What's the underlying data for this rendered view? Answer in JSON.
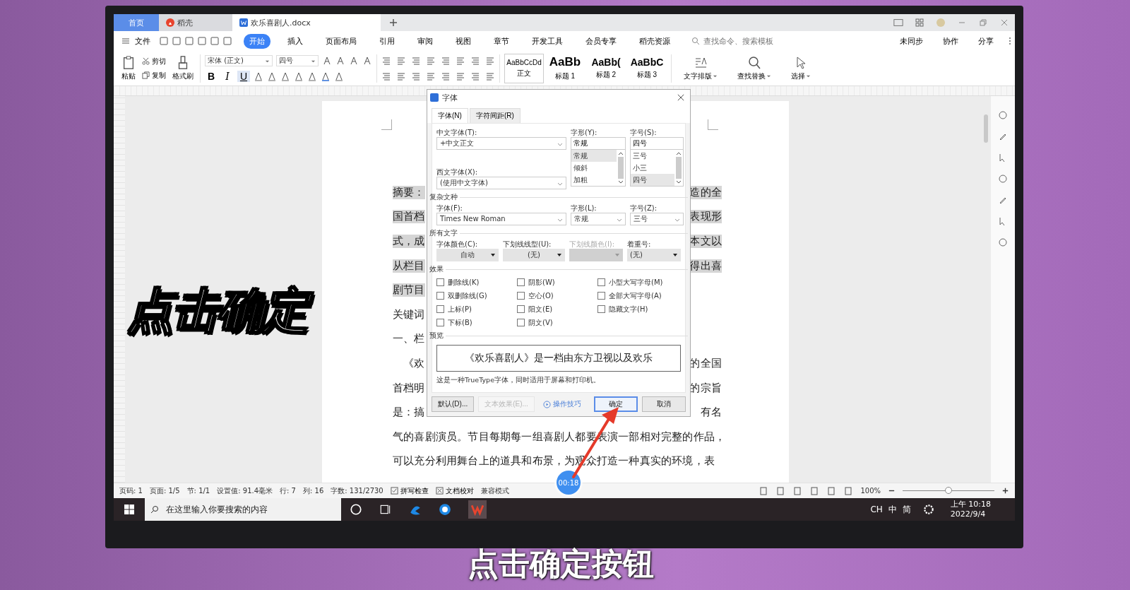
{
  "app_tabs": [
    {
      "label": "首页",
      "kind": "home",
      "selected": false
    },
    {
      "label": "稻壳",
      "kind": "app",
      "selected": false
    },
    {
      "label": "欢乐喜剧人.docx",
      "kind": "doc",
      "selected": true
    }
  ],
  "file_menu": "文件",
  "ribbon_tabs": [
    {
      "label": "开始",
      "selected": true
    },
    {
      "label": "插入",
      "selected": false
    },
    {
      "label": "页面布局",
      "selected": false
    },
    {
      "label": "引用",
      "selected": false
    },
    {
      "label": "审阅",
      "selected": false
    },
    {
      "label": "视图",
      "selected": false
    },
    {
      "label": "章节",
      "selected": false
    },
    {
      "label": "开发工具",
      "selected": false
    },
    {
      "label": "会员专享",
      "selected": false
    },
    {
      "label": "稻壳资源",
      "selected": false
    }
  ],
  "command_search": {
    "placeholder": "查找命令、搜索模板"
  },
  "header_actions": [
    "未同步",
    "协作",
    "分享"
  ],
  "clipboard": {
    "paste": "粘贴",
    "cut": "剪切",
    "copy": "复制",
    "format_painter": "格式刷"
  },
  "font_name": "宋体 (正文)",
  "font_size": "四号",
  "format_buttons": [
    "B",
    "I",
    "U"
  ],
  "styles": [
    {
      "sample": "AaBbCcDd",
      "name": "正文",
      "selected": true
    },
    {
      "sample": "AaBb",
      "name": "标题 1",
      "selected": false
    },
    {
      "sample": "AaBb(",
      "name": "标题 2",
      "selected": false
    },
    {
      "sample": "AaBbC",
      "name": "标题 3",
      "selected": false
    }
  ],
  "tools": [
    "文字排版",
    "查找替换",
    "选择"
  ],
  "document": {
    "lines": [
      {
        "left": "摘要：",
        "right": "造的全",
        "highlighted": true
      },
      {
        "left": "国首档",
        "right": "表现形",
        "highlighted": true
      },
      {
        "left": "式，成",
        "right": "本文以",
        "highlighted": true
      },
      {
        "left": "从栏目",
        "right": "得出喜",
        "highlighted": true
      },
      {
        "left": "剧节目",
        "highlighted": true
      },
      {
        "left": "关键词",
        "highlighted": false
      },
      {
        "left": "一、栏",
        "highlighted": false
      },
      {
        "left": "　《欢",
        "right": "的全国",
        "highlighted": false
      },
      {
        "left": "首档明",
        "right": "的宗旨",
        "highlighted": false
      },
      {
        "left": "是：搞",
        "right": "有名",
        "highlighted": false
      },
      {
        "left": "气的喜剧演员。节目每期每一组喜剧人都要表演一部相对完整的作品，",
        "highlighted": false
      },
      {
        "left": "可以充分利用舞台上的道具和布景，为观众打造一种真实的环境，表",
        "highlighted": false
      }
    ]
  },
  "dialog": {
    "title": "字体",
    "tabs": [
      {
        "label": "字体(N)",
        "selected": true
      },
      {
        "label": "字符间距(R)",
        "selected": false
      }
    ],
    "chinese_font": {
      "label": "中文字体(T):",
      "value": "+中文正文"
    },
    "western_font": {
      "label": "西文字体(X):",
      "value": "(使用中文字体)"
    },
    "style": {
      "label": "字形(Y):",
      "value": "常规",
      "options": [
        {
          "label": "常规",
          "selected": true
        },
        {
          "label": "倾斜",
          "selected": false
        },
        {
          "label": "加粗",
          "selected": false
        }
      ]
    },
    "size": {
      "label": "字号(S):",
      "value": "四号",
      "options": [
        {
          "label": "三号",
          "selected": false
        },
        {
          "label": "小三",
          "selected": false
        },
        {
          "label": "四号",
          "selected": true
        }
      ]
    },
    "complex_section": "复杂文种",
    "complex_fields": [
      {
        "label": "字体(F):",
        "value": "Times New Roman"
      },
      {
        "label": "字形(L):",
        "value": "常规"
      },
      {
        "label": "字号(Z):",
        "value": "三号"
      }
    ],
    "all_text_section": "所有文字",
    "all_text_fields": [
      {
        "label": "字体颜色(C):",
        "value": "自动",
        "disabled": false
      },
      {
        "label": "下划线线型(U):",
        "value": "(无)",
        "disabled": false
      },
      {
        "label": "下划线颜色(I):",
        "disabled": true
      },
      {
        "label": "着重号:",
        "value": "(无)",
        "disabled": false
      }
    ],
    "effects_section": "效果",
    "effects": [
      {
        "label": "删除线(K)",
        "checked": false
      },
      {
        "label": "阴影(W)",
        "checked": false
      },
      {
        "label": "小型大写字母(M)",
        "checked": false
      },
      {
        "label": "双删除线(G)",
        "checked": false
      },
      {
        "label": "空心(O)",
        "checked": false
      },
      {
        "label": "全部大写字母(A)",
        "checked": false
      },
      {
        "label": "上标(P)",
        "checked": false
      },
      {
        "label": "阳文(E)",
        "checked": false
      },
      {
        "label": "隐藏文字(H)",
        "checked": false
      },
      {
        "label": "下标(B)",
        "checked": false
      },
      {
        "label": "阴文(V)",
        "checked": false
      }
    ],
    "preview_section": "预览",
    "preview_text": "《欢乐喜剧人》是一档由东方卫视以及欢乐",
    "note": "这是一种TrueType字体，同时适用于屏幕和打印机。",
    "buttons": [
      {
        "label": "默认(D)...",
        "kind": "plain",
        "disabled": false
      },
      {
        "label": "文本效果(E)...",
        "kind": "plain",
        "disabled": true
      },
      {
        "label": "操作技巧",
        "kind": "link",
        "disabled": false
      },
      {
        "label": "确定",
        "kind": "primary",
        "disabled": false
      },
      {
        "label": "取消",
        "kind": "plain",
        "disabled": false
      }
    ]
  },
  "status_bar": {
    "items": [
      "页码: 1",
      "页面: 1/5",
      "节: 1/1",
      "设置值: 91.4毫米",
      "行: 7",
      "列: 16",
      "字数: 131/2730"
    ],
    "spell_check": "拼写检查",
    "proofread": "文档校对",
    "mode": "兼容模式",
    "zoom": "100%",
    "zoom_slider": {
      "level": 0.5
    }
  },
  "taskbar": {
    "search": {
      "placeholder": "在这里输入你要搜索的内容"
    },
    "tray": [
      "CH",
      "中",
      "简"
    ],
    "time": "上午 10:18",
    "date": "2022/9/4"
  },
  "overlays": {
    "caption": "点击确定",
    "subtitle": "点击确定按钮",
    "timer": "00:18"
  }
}
